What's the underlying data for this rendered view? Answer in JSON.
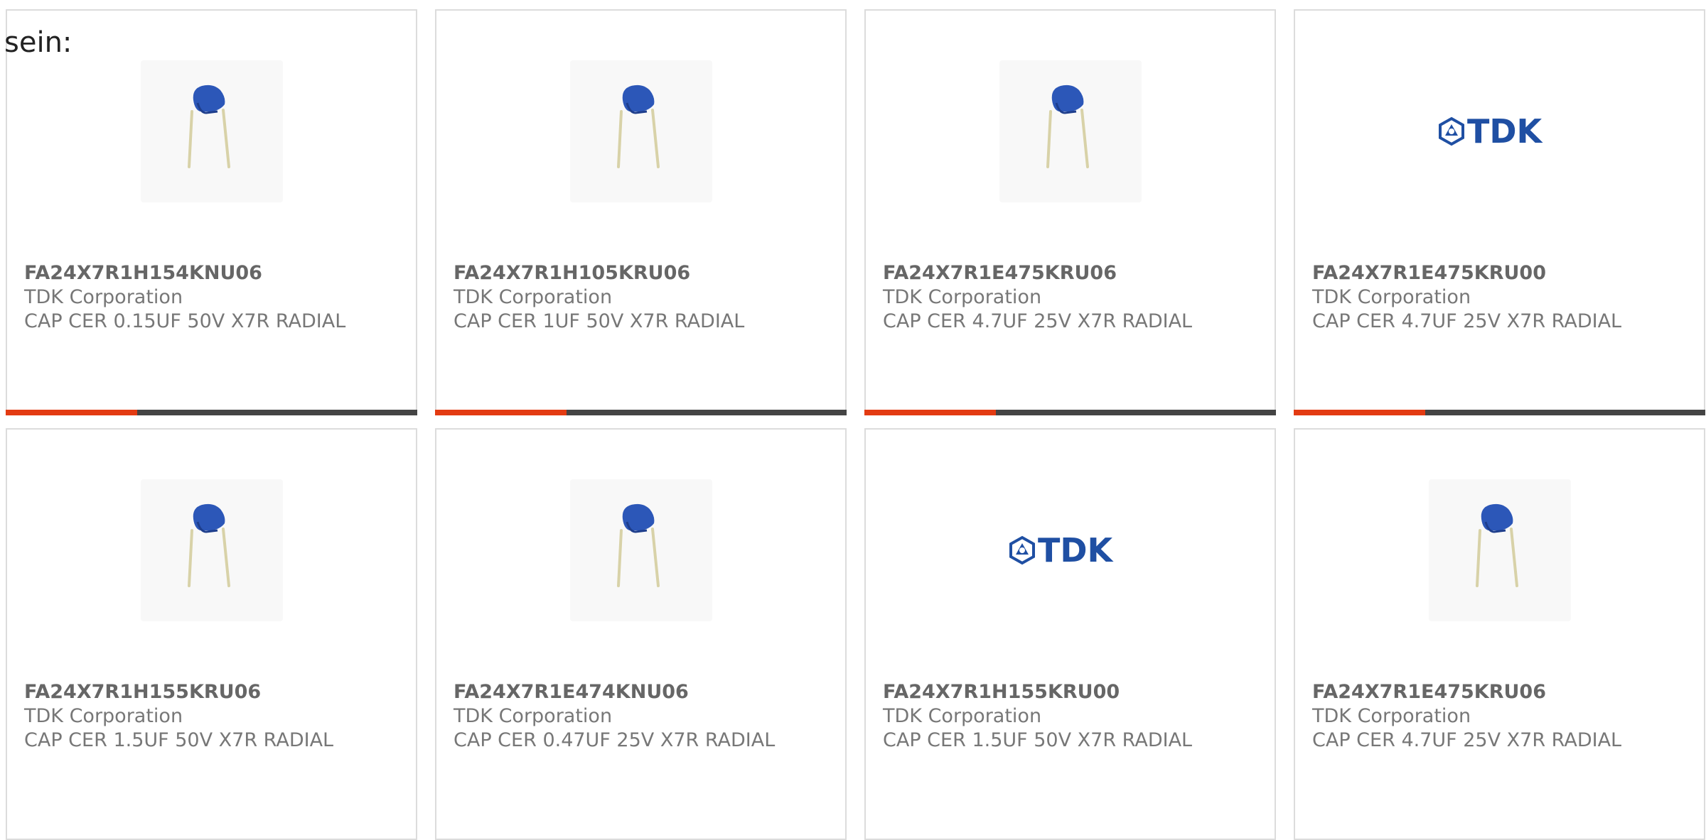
{
  "intro_text": "sein:",
  "colors": {
    "accent": "#e33b12",
    "bar_track": "#444444",
    "card_border": "#dcdcdc",
    "capacitor_blue": "#2c57b8"
  },
  "products": [
    {
      "part_number": "FA24X7R1H154KNU06",
      "manufacturer": "TDK Corporation",
      "description": "CAP CER 0.15UF 50V X7R RADIAL",
      "image": "capacitor-image",
      "progress": 0.32
    },
    {
      "part_number": "FA24X7R1H105KRU06",
      "manufacturer": "TDK Corporation",
      "description": "CAP CER 1UF 50V X7R RADIAL",
      "image": "capacitor-image",
      "progress": 0.32
    },
    {
      "part_number": "FA24X7R1E475KRU06",
      "manufacturer": "TDK Corporation",
      "description": "CAP CER 4.7UF 25V X7R RADIAL",
      "image": "capacitor-image",
      "progress": 0.32
    },
    {
      "part_number": "FA24X7R1E475KRU00",
      "manufacturer": "TDK Corporation",
      "description": "CAP CER 4.7UF 25V X7R RADIAL",
      "image": "tdk-logo",
      "logo_text": "TDK",
      "progress": 0.32
    },
    {
      "part_number": "FA24X7R1H155KRU06",
      "manufacturer": "TDK Corporation",
      "description": "CAP CER 1.5UF 50V X7R RADIAL",
      "image": "capacitor-image"
    },
    {
      "part_number": "FA24X7R1E474KNU06",
      "manufacturer": "TDK Corporation",
      "description": "CAP CER 0.47UF 25V X7R RADIAL",
      "image": "capacitor-image"
    },
    {
      "part_number": "FA24X7R1H155KRU00",
      "manufacturer": "TDK Corporation",
      "description": "CAP CER 1.5UF 50V X7R RADIAL",
      "image": "tdk-logo",
      "logo_text": "TDK"
    },
    {
      "part_number": "FA24X7R1E475KRU06",
      "manufacturer": "TDK Corporation",
      "description": "CAP CER 4.7UF 25V X7R RADIAL",
      "image": "capacitor-image"
    }
  ]
}
